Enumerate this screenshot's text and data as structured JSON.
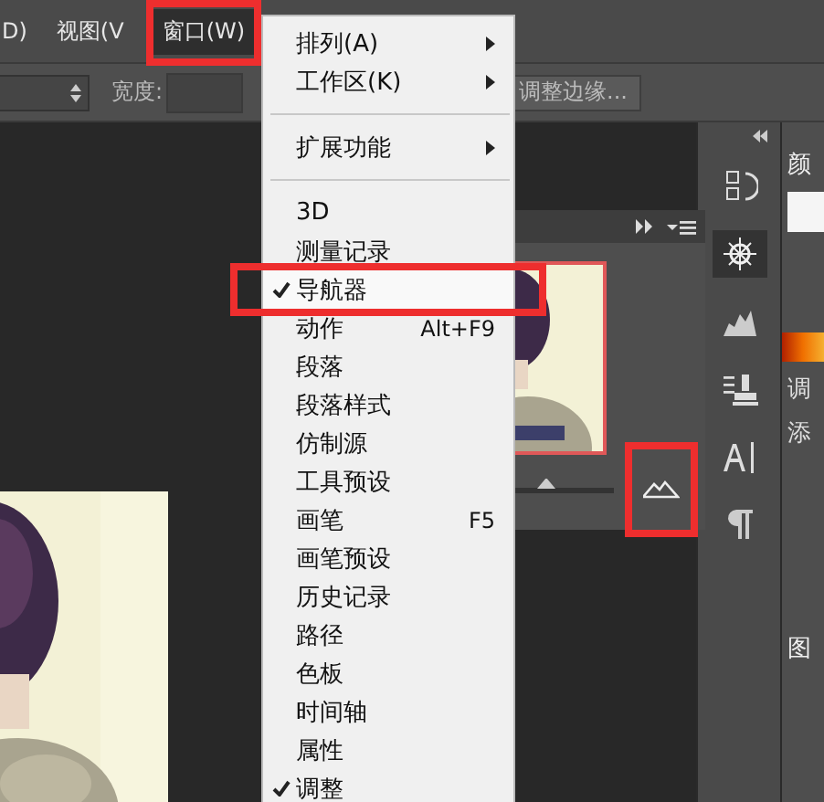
{
  "menu_bar": {
    "items": [
      {
        "label": "D)",
        "selected": false,
        "highlighted": false
      },
      {
        "label": "视图(V",
        "selected": false,
        "highlighted": false
      },
      {
        "label": "窗口(W)",
        "selected": true,
        "highlighted": true
      }
    ]
  },
  "options_bar": {
    "width_label": "宽度:",
    "refine_button": "调整边缘..."
  },
  "window_menu": {
    "items": [
      {
        "kind": "item",
        "label": "排列(A)",
        "submenu": true,
        "checked": false,
        "highlighted": false
      },
      {
        "kind": "item",
        "label": "工作区(K)",
        "submenu": true,
        "checked": false,
        "highlighted": false
      },
      {
        "kind": "separator"
      },
      {
        "kind": "item",
        "label": "扩展功能",
        "submenu": true,
        "checked": false,
        "highlighted": false
      },
      {
        "kind": "separator"
      },
      {
        "kind": "item",
        "label": "3D",
        "submenu": false,
        "checked": false,
        "highlighted": false
      },
      {
        "kind": "item",
        "label": "测量记录",
        "submenu": false,
        "checked": false,
        "highlighted": false
      },
      {
        "kind": "item",
        "label": "导航器",
        "submenu": false,
        "checked": true,
        "highlighted": true
      },
      {
        "kind": "item",
        "label": "动作",
        "shortcut": "Alt+F9",
        "submenu": false,
        "checked": false,
        "highlighted": false
      },
      {
        "kind": "item",
        "label": "段落",
        "submenu": false,
        "checked": false,
        "highlighted": false
      },
      {
        "kind": "item",
        "label": "段落样式",
        "submenu": false,
        "checked": false,
        "highlighted": false
      },
      {
        "kind": "item",
        "label": "仿制源",
        "submenu": false,
        "checked": false,
        "highlighted": false
      },
      {
        "kind": "item",
        "label": "工具预设",
        "submenu": false,
        "checked": false,
        "highlighted": false
      },
      {
        "kind": "item",
        "label": "画笔",
        "shortcut": "F5",
        "submenu": false,
        "checked": false,
        "highlighted": false
      },
      {
        "kind": "item",
        "label": "画笔预设",
        "submenu": false,
        "checked": false,
        "highlighted": false
      },
      {
        "kind": "item",
        "label": "历史记录",
        "submenu": false,
        "checked": false,
        "highlighted": false
      },
      {
        "kind": "item",
        "label": "路径",
        "submenu": false,
        "checked": false,
        "highlighted": false
      },
      {
        "kind": "item",
        "label": "色板",
        "submenu": false,
        "checked": false,
        "highlighted": false
      },
      {
        "kind": "item",
        "label": "时间轴",
        "submenu": false,
        "checked": false,
        "highlighted": false
      },
      {
        "kind": "item",
        "label": "属性",
        "submenu": false,
        "checked": false,
        "highlighted": false
      },
      {
        "kind": "item",
        "label": "调整",
        "submenu": false,
        "checked": true,
        "highlighted": false
      }
    ]
  },
  "navigator": {
    "level": 0.63,
    "zoom_in_highlighted": true
  },
  "right_panel": {
    "color_tab": "颜",
    "adjust_label": "调",
    "add_label": "添",
    "layers_tab": "图"
  }
}
